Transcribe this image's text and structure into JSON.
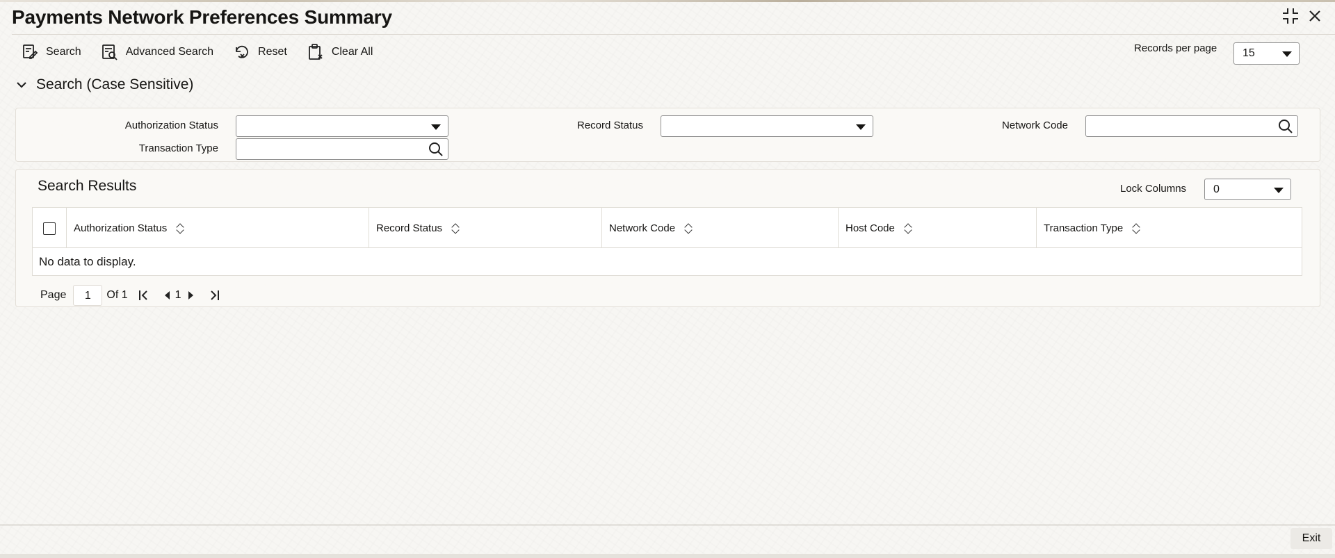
{
  "window": {
    "title": "Payments Network Preferences Summary",
    "maximize_icon": "maximize-icon",
    "close_icon": "close-icon"
  },
  "toolbar": {
    "search_label": "Search",
    "advanced_search_label": "Advanced Search",
    "reset_label": "Reset",
    "clear_all_label": "Clear All"
  },
  "records_per_page": {
    "label": "Records per page",
    "value": "15"
  },
  "search_section": {
    "title": "Search (Case Sensitive)",
    "fields": {
      "authorization_status": {
        "label": "Authorization Status",
        "value": ""
      },
      "record_status": {
        "label": "Record Status",
        "value": ""
      },
      "network_code": {
        "label": "Network Code",
        "value": ""
      },
      "transaction_type": {
        "label": "Transaction Type",
        "value": ""
      }
    }
  },
  "results": {
    "title": "Search Results",
    "lock_columns": {
      "label": "Lock Columns",
      "value": "0"
    },
    "columns": [
      "Authorization Status",
      "Record Status",
      "Network Code",
      "Host Code",
      "Transaction Type"
    ],
    "empty_message": "No data to display."
  },
  "pagination": {
    "page_label": "Page",
    "current_page": "1",
    "of_label": "Of 1",
    "page_number": "1"
  },
  "footer": {
    "exit_label": "Exit"
  }
}
